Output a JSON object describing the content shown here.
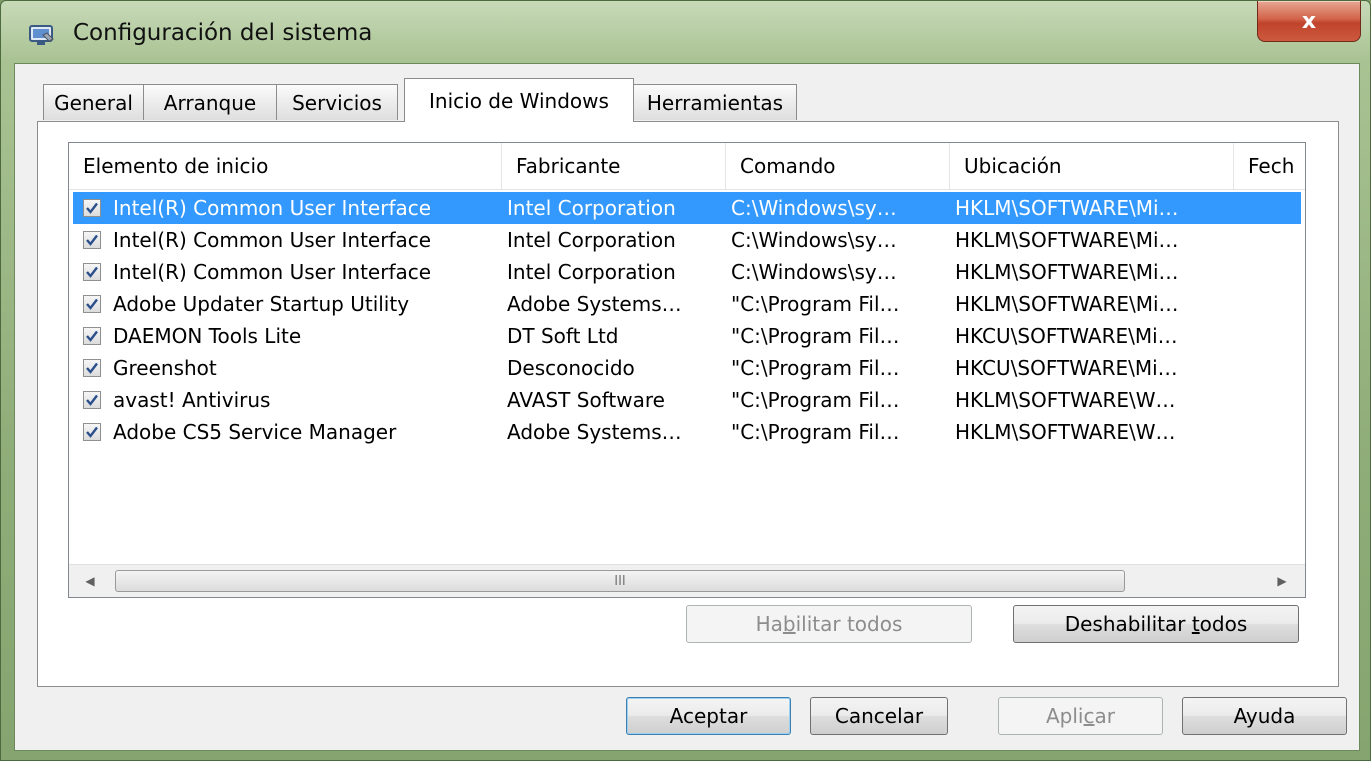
{
  "window": {
    "title": "Configuración del sistema",
    "close_label": "x"
  },
  "tabs": [
    {
      "label": "General"
    },
    {
      "label": "Arranque"
    },
    {
      "label": "Servicios"
    },
    {
      "label": "Inicio de Windows",
      "active": true
    },
    {
      "label": "Herramientas"
    }
  ],
  "startup_list": {
    "columns": [
      "Elemento de inicio",
      "Fabricante",
      "Comando",
      "Ubicación",
      "Fech"
    ],
    "rows": [
      {
        "checked": true,
        "selected": true,
        "item": "Intel(R) Common User Interface",
        "manufacturer": "Intel Corporation",
        "command": "C:\\Windows\\sy…",
        "location": "HKLM\\SOFTWARE\\Mi…"
      },
      {
        "checked": true,
        "item": "Intel(R) Common User Interface",
        "manufacturer": "Intel Corporation",
        "command": "C:\\Windows\\sy…",
        "location": "HKLM\\SOFTWARE\\Mi…"
      },
      {
        "checked": true,
        "item": "Intel(R) Common User Interface",
        "manufacturer": "Intel Corporation",
        "command": "C:\\Windows\\sy…",
        "location": "HKLM\\SOFTWARE\\Mi…"
      },
      {
        "checked": true,
        "item": "Adobe Updater Startup Utility",
        "manufacturer": "Adobe Systems…",
        "command": "\"C:\\Program Fil…",
        "location": "HKLM\\SOFTWARE\\Mi…"
      },
      {
        "checked": true,
        "item": "DAEMON Tools Lite",
        "manufacturer": "DT Soft Ltd",
        "command": "\"C:\\Program Fil…",
        "location": "HKCU\\SOFTWARE\\Mi…"
      },
      {
        "checked": true,
        "item": "Greenshot",
        "manufacturer": "Desconocido",
        "command": "\"C:\\Program Fil…",
        "location": "HKCU\\SOFTWARE\\Mi…"
      },
      {
        "checked": true,
        "item": "avast! Antivirus",
        "manufacturer": "AVAST Software",
        "command": "\"C:\\Program Fil…",
        "location": "HKLM\\SOFTWARE\\W…"
      },
      {
        "checked": true,
        "item": "Adobe CS5 Service Manager",
        "manufacturer": "Adobe Systems…",
        "command": "\"C:\\Program Fil…",
        "location": "HKLM\\SOFTWARE\\W…"
      }
    ],
    "scroll_thumb_grip": "III"
  },
  "panel_buttons": {
    "enable_all": {
      "label_pre": "Ha",
      "label_ul": "b",
      "label_post": "ilitar todos",
      "disabled": true
    },
    "disable_all": {
      "label_pre": "Deshabilitar ",
      "label_ul": "t",
      "label_post": "odos"
    }
  },
  "dialog_buttons": {
    "ok": "Aceptar",
    "cancel": "Cancelar",
    "apply": {
      "label_pre": "Apli",
      "label_ul": "c",
      "label_post": "ar",
      "disabled": true
    },
    "help": "Ayuda"
  },
  "colors": {
    "selection": "#3399ff",
    "frame": "#8fad78",
    "close_button": "#c7432b"
  }
}
